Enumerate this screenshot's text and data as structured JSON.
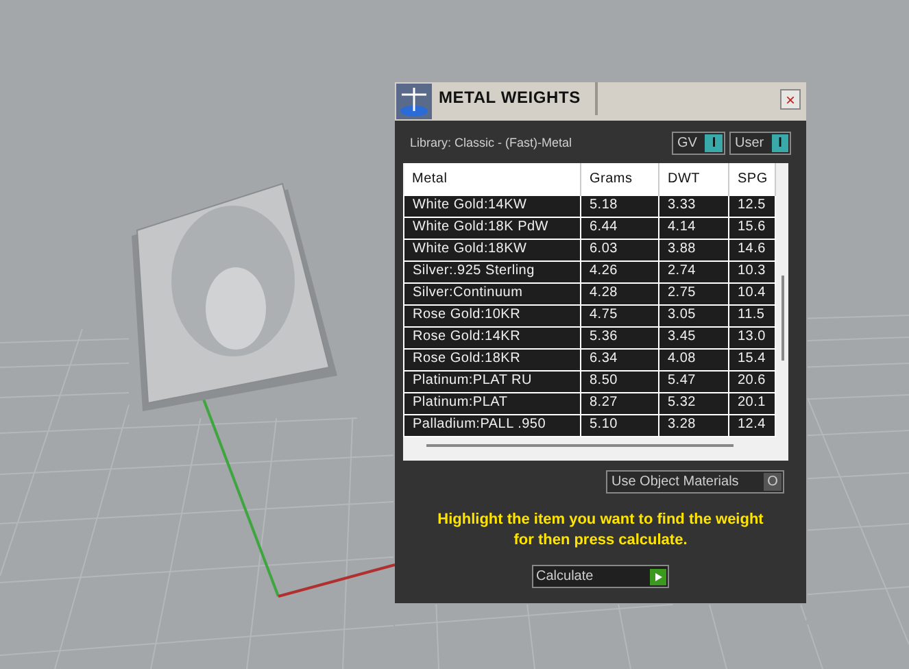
{
  "window": {
    "title": "METAL WEIGHTS",
    "close": "×"
  },
  "library": "Library: Classic - (Fast)-Metal",
  "toggles": [
    {
      "label": "GV",
      "indicator": "I",
      "on": true
    },
    {
      "label": "User",
      "indicator": "I",
      "on": true
    }
  ],
  "table": {
    "columns": [
      "Metal",
      "Grams",
      "DWT",
      "SPG"
    ],
    "rows": [
      [
        "White Gold:14KW",
        "5.18",
        "3.33",
        "12.5"
      ],
      [
        "White Gold:18K PdW",
        "6.44",
        "4.14",
        "15.6"
      ],
      [
        "White Gold:18KW",
        "6.03",
        "3.88",
        "14.6"
      ],
      [
        "Silver:.925 Sterling",
        "4.26",
        "2.74",
        "10.3"
      ],
      [
        "Silver:Continuum",
        "4.28",
        "2.75",
        "10.4"
      ],
      [
        "Rose Gold:10KR",
        "4.75",
        "3.05",
        "11.5"
      ],
      [
        "Rose Gold:14KR",
        "5.36",
        "3.45",
        "13.0"
      ],
      [
        "Rose Gold:18KR",
        "6.34",
        "4.08",
        "15.4"
      ],
      [
        "Platinum:PLAT RU",
        "8.50",
        "5.47",
        "20.6"
      ],
      [
        "Platinum:PLAT",
        "8.27",
        "5.32",
        "20.1"
      ],
      [
        "Palladium:PALL .950",
        "5.10",
        "3.28",
        "12.4"
      ]
    ]
  },
  "use_object_materials": {
    "label": "Use Object Materials",
    "indicator": "O",
    "on": false
  },
  "hint": "Highlight the item you want to find the weight for then press calculate.",
  "calculate_button": "Calculate"
}
